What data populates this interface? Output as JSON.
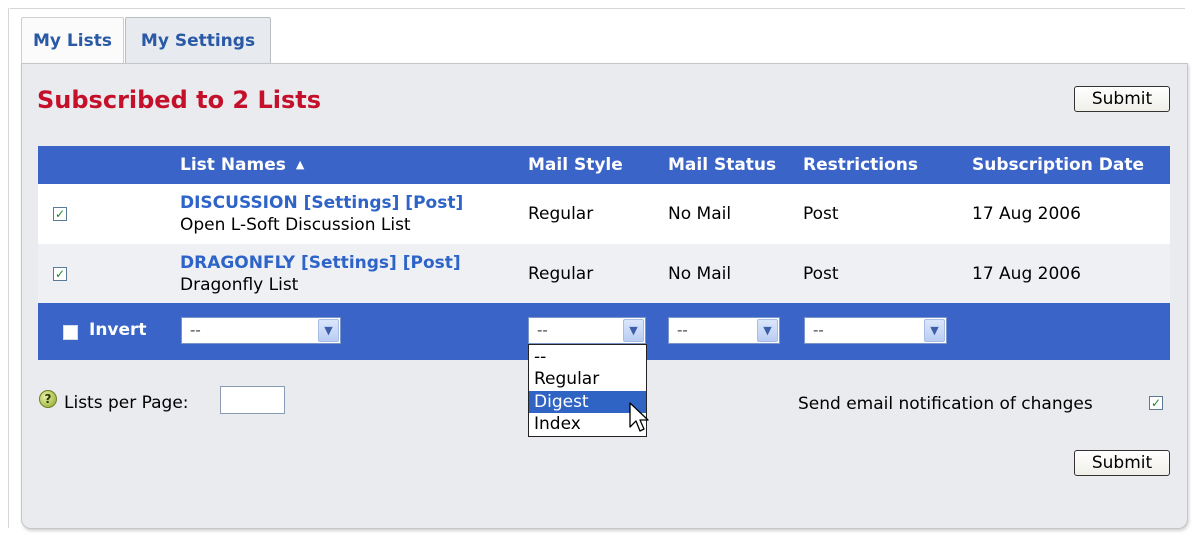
{
  "tabs": [
    {
      "label": "My Lists"
    },
    {
      "label": "My Settings"
    }
  ],
  "page_title": "Subscribed to 2 Lists",
  "submit_label": "Submit",
  "table": {
    "headers": {
      "list_names": "List Names",
      "sort_indicator": "▲",
      "mail_style": "Mail Style",
      "mail_status": "Mail Status",
      "restrictions": "Restrictions",
      "subscription_date": "Subscription Date"
    },
    "rows": [
      {
        "checked": true,
        "name_link": "DISCUSSION [Settings] [Post]",
        "description": "Open L-Soft Discussion List",
        "mail_style": "Regular",
        "mail_status": "No Mail",
        "restrictions": "Post",
        "subscription_date": "17 Aug 2006"
      },
      {
        "checked": true,
        "name_link": "DRAGONFLY [Settings] [Post]",
        "description": "Dragonfly List",
        "mail_style": "Regular",
        "mail_status": "No Mail",
        "restrictions": "Post",
        "subscription_date": "17 Aug 2006"
      }
    ]
  },
  "filter_bar": {
    "invert_label": "Invert",
    "invert_checked": false,
    "list_names_select": "--",
    "mail_style_select": "--",
    "mail_status_select": "--",
    "restrictions_select": "--"
  },
  "mail_style_dropdown": {
    "options": [
      "--",
      "Regular",
      "Digest",
      "Index"
    ],
    "highlighted": "Digest"
  },
  "lists_per_page": {
    "label": "Lists per Page:",
    "value": "",
    "help_icon": "help-icon"
  },
  "notify": {
    "label": "Send email notification of changes",
    "checked": true
  },
  "colors": {
    "accent_blue": "#3a64c7",
    "title_red": "#c4102a",
    "link_blue": "#2e63c8",
    "panel_bg": "#e9ebef"
  },
  "check_glyph": "✓"
}
